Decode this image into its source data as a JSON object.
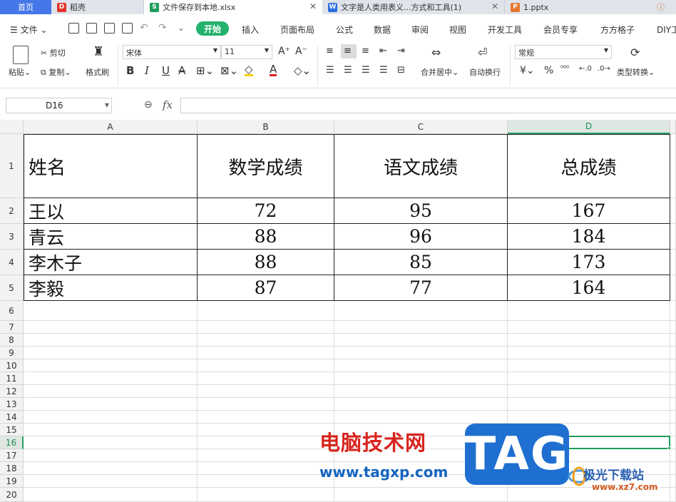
{
  "tabs": [
    {
      "label": "首页",
      "icon": ""
    },
    {
      "label": "稻壳",
      "icon": "D"
    },
    {
      "label": "文件保存到本地.xlsx",
      "icon": "S"
    },
    {
      "label": "文字是人类用表义...方式和工具(1)",
      "icon": "W"
    },
    {
      "label": "1.pptx",
      "icon": "P"
    }
  ],
  "menu": {
    "file": "文件",
    "start": "开始",
    "items": [
      "插入",
      "页面布局",
      "公式",
      "数据",
      "审阅",
      "视图",
      "开发工具",
      "会员专享",
      "方方格子",
      "DIY工"
    ]
  },
  "ribbon": {
    "paste": "粘贴",
    "cut": "剪切",
    "copy": "复制",
    "format_painter": "格式刷",
    "font_name": "宋体",
    "font_size": "11",
    "merge_center": "合并居中",
    "wrap_text": "自动换行",
    "number_format": "常规",
    "type_convert": "类型转换",
    "currency": "¥",
    "percent": "%"
  },
  "formula_bar": {
    "cell_ref": "D16",
    "fx": "fx",
    "value": ""
  },
  "columns": [
    "A",
    "B",
    "C",
    "D"
  ],
  "selected_col": "D",
  "selected_row": "16",
  "row_numbers": [
    "1",
    "2",
    "3",
    "4",
    "5",
    "6",
    "7",
    "8",
    "9",
    "10",
    "11",
    "12",
    "13",
    "14",
    "15",
    "16",
    "17",
    "18",
    "19",
    "20"
  ],
  "table": {
    "headers": [
      "姓名",
      "数学成绩",
      "语文成绩",
      "总成绩"
    ],
    "rows": [
      [
        "王以",
        "72",
        "95",
        "167"
      ],
      [
        "青云",
        "88",
        "96",
        "184"
      ],
      [
        "李木子",
        "88",
        "85",
        "173"
      ],
      [
        "李毅",
        "87",
        "77",
        "164"
      ]
    ]
  },
  "watermark": {
    "line1": "电脑技术网",
    "line2": "www.tagxp.com",
    "badge": "TAG",
    "site_name": "极光下载站",
    "site_url": "www.xz7.com"
  }
}
